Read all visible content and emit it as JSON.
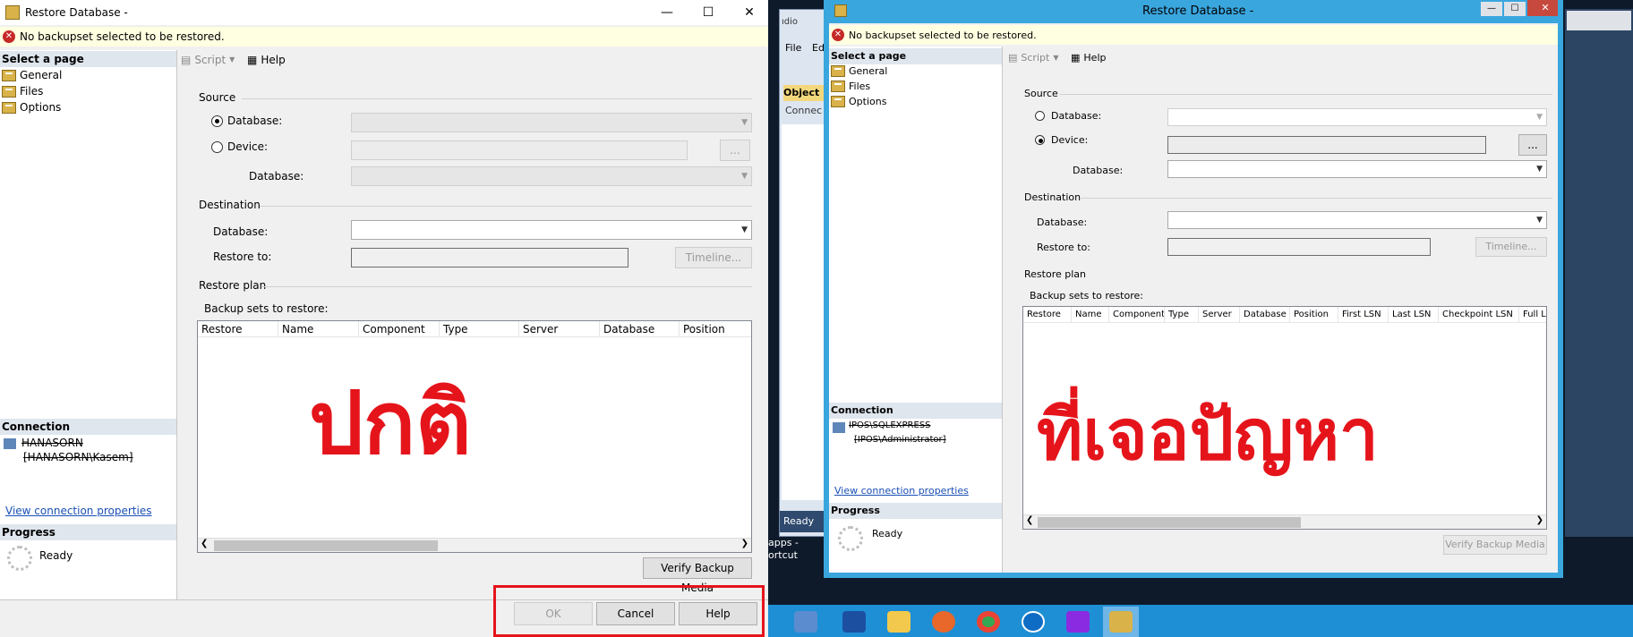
{
  "left_dialog": {
    "title": "Restore Database -",
    "error": "No backupset selected to be restored.",
    "select_page_header": "Select a page",
    "pages": [
      "General",
      "Files",
      "Options"
    ],
    "toolbar": {
      "script": "Script",
      "help": "Help"
    },
    "source": {
      "group": "Source",
      "database_label": "Database:",
      "device_label": "Device:",
      "sub_database_label": "Database:",
      "selected": "database",
      "browse_label": "..."
    },
    "destination": {
      "group": "Destination",
      "database_label": "Database:",
      "restore_to_label": "Restore to:",
      "timeline_label": "Timeline..."
    },
    "restore_plan": {
      "group": "Restore plan",
      "backup_sets_label": "Backup sets to restore:",
      "columns": [
        "Restore",
        "Name",
        "Component",
        "Type",
        "Server",
        "Database",
        "Position"
      ]
    },
    "connection_header": "Connection",
    "connection_server": "HANASORN",
    "connection_user": "[HANASORN\\Kasem]",
    "view_connection": "View connection properties",
    "progress_header": "Progress",
    "progress_status": "Ready",
    "verify_label": "Verify Backup Media",
    "ok_label": "OK",
    "cancel_label": "Cancel",
    "help_label": "Help",
    "overlay_text": "ปกติ"
  },
  "right_dialog": {
    "title": "Restore Database -",
    "error": "No backupset selected to be restored.",
    "select_page_header": "Select a page",
    "pages": [
      "General",
      "Files",
      "Options"
    ],
    "toolbar": {
      "script": "Script",
      "help": "Help"
    },
    "source": {
      "group": "Source",
      "database_label": "Database:",
      "device_label": "Device:",
      "sub_database_label": "Database:",
      "selected": "device",
      "browse_label": "..."
    },
    "destination": {
      "group": "Destination",
      "database_label": "Database:",
      "restore_to_label": "Restore to:",
      "timeline_label": "Timeline..."
    },
    "restore_plan": {
      "group": "Restore plan",
      "backup_sets_label": "Backup sets to restore:",
      "columns": [
        "Restore",
        "Name",
        "Component",
        "Type",
        "Server",
        "Database",
        "Position",
        "First LSN",
        "Last LSN",
        "Checkpoint LSN",
        "Full L"
      ]
    },
    "connection_header": "Connection",
    "connection_server": "IPOS\\SQLEXPRESS",
    "connection_user": "[IPOS\\Administrator]",
    "view_connection": "View connection properties",
    "progress_header": "Progress",
    "progress_status": "Ready",
    "verify_label": "Verify Backup Media",
    "overlay_text": "ที่เจอปัญหา"
  },
  "background_app": {
    "menu_file": "File",
    "menu_edit": "Edi",
    "object_explorer": "Object E",
    "connect": "Connec",
    "status": "Ready",
    "title_fragment": "ıdio",
    "desktop_label": "apps -\nortcut"
  },
  "taskbar": {
    "icons": [
      "file-explorer-icon",
      "powershell-icon",
      "folder-icon",
      "firefox-icon",
      "chrome-icon",
      "teamviewer-icon",
      "search-app-icon",
      "sql-tools-icon"
    ]
  }
}
